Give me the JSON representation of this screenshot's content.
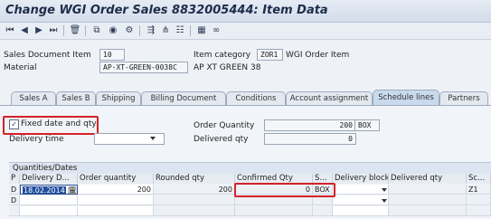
{
  "window": {
    "title": "Change WGI Order Sales 8832005444: Item Data"
  },
  "toolbar": {
    "icons": [
      "first-page-icon",
      "previous-page-icon",
      "next-page-icon",
      "last-page-icon",
      "delete-icon",
      "copy-icon",
      "display-icon",
      "configure-icon",
      "subitems-icon",
      "document-flow-icon",
      "overview-icon",
      "glasses-icon"
    ]
  },
  "header": {
    "sd_item_label": "Sales Document Item",
    "sd_item_value": "10",
    "item_category_label": "Item category",
    "item_category_value": "ZOR1",
    "item_category_desc": "WGI Order Item",
    "material_label": "Material",
    "material_value": "AP-XT-GREEN-0038C",
    "material_desc": "AP XT GREEN 38"
  },
  "tabs": [
    "Sales A",
    "Sales B",
    "Shipping",
    "Billing Document",
    "Conditions",
    "Account assignment",
    "Schedule lines",
    "Partners"
  ],
  "active_tab": "Schedule lines",
  "schedule": {
    "fixed_label": "Fixed date and qty",
    "fixed_checked": true,
    "delivery_time_label": "Delivery time",
    "delivery_time_value": "",
    "order_qty_label": "Order Quantity",
    "order_qty_value": "200",
    "order_qty_unit": "BOX",
    "delivered_qty_label": "Delivered qty",
    "delivered_qty_value": "0"
  },
  "table": {
    "title": "Quantities/Dates",
    "columns": [
      "P",
      "Delivery D...",
      "Order quantity",
      "Rounded qty",
      "Confirmed Qty",
      "S...",
      "Delivery block",
      "Delivered qty",
      "Sc..."
    ],
    "rows": [
      {
        "p": "D",
        "date": "18.02.2014",
        "order_qty": "200",
        "rounded_qty": "200",
        "confirmed_qty": "0",
        "unit": "BOX",
        "block": "",
        "delivered": "",
        "sc": "Z1"
      },
      {
        "p": "D",
        "date": "",
        "order_qty": "",
        "rounded_qty": "",
        "confirmed_qty": "",
        "unit": "",
        "block": "",
        "delivered": "",
        "sc": ""
      }
    ]
  },
  "colors": {
    "highlight": "#d32228",
    "active_tab": "#c9d9ee",
    "title": "#1d2d4a"
  }
}
